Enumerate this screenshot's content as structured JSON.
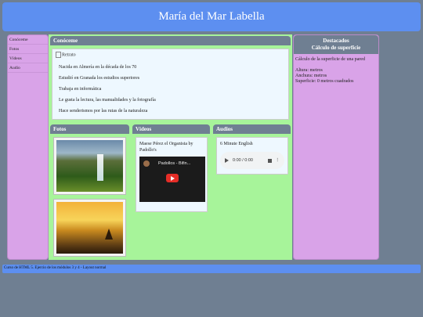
{
  "header": {
    "title": "María del Mar Labella"
  },
  "nav": {
    "items": [
      "Conóceme",
      "Fotos",
      "Vídeos",
      "Audio"
    ]
  },
  "about": {
    "title": "Conóceme",
    "portrait_alt": "Retrato",
    "lines": [
      "Nacida en Almería en la década de los 70",
      "Estudió en Granada los estudios superiores",
      "Trabaja en informática",
      "Le gusta la lectura, las manualidades y la fotografía",
      "Hace senderismos por las rutas de la naturaleza"
    ]
  },
  "photos": {
    "title": "Fotos"
  },
  "videos": {
    "title": "Vídeos",
    "caption": "Maese Pérez el Organista by Padollo's",
    "thumb_title": "Padollos - Bifin..."
  },
  "audio": {
    "title": "Audios",
    "caption": "6 Minute English",
    "time": "0:00 / 0:00"
  },
  "aside": {
    "title_line1": "Destacados",
    "title_line2": "Cálculo de superficie",
    "desc": "Cálculo de la superficie de una pared",
    "height": "Altura: metros",
    "width": "Anchura: metros",
    "surface": "Superficie: 0 metros cuadrados"
  },
  "footer": {
    "text": "Curso de HTML 5. Ejercio de los módulos 3 y 4 - Layout normal"
  },
  "colors": {
    "header": "#5d8ff0",
    "nav": "#d9a3e8",
    "main": "#a7f49a",
    "title_bar": "#6f7f92"
  }
}
